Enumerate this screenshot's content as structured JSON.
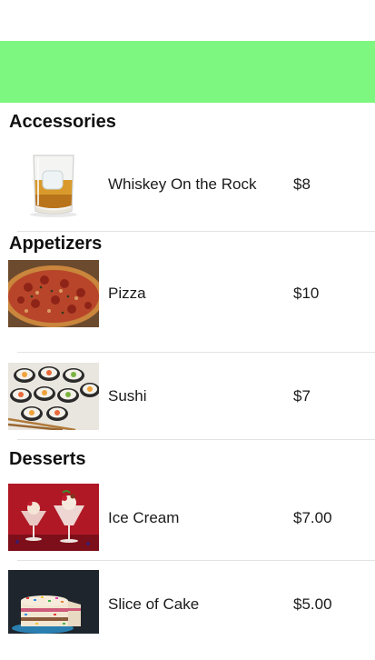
{
  "sections": [
    {
      "title": "Accessories",
      "items": [
        {
          "name": "Whiskey On the Rock",
          "price": "$8",
          "image_icon": "whiskey-glass-image"
        }
      ]
    },
    {
      "title": "Appetizers",
      "items": [
        {
          "name": "Pizza",
          "price": "$10",
          "image_icon": "pizza-image"
        },
        {
          "name": "Sushi",
          "price": "$7",
          "image_icon": "sushi-image"
        }
      ]
    },
    {
      "title": "Desserts",
      "items": [
        {
          "name": "Ice Cream",
          "price": "$7.00",
          "image_icon": "ice-cream-image"
        },
        {
          "name": "Slice of Cake",
          "price": "$5.00",
          "image_icon": "cake-image"
        }
      ]
    }
  ],
  "colors": {
    "header": "#7df77f",
    "separator": "#e3e3e3"
  }
}
